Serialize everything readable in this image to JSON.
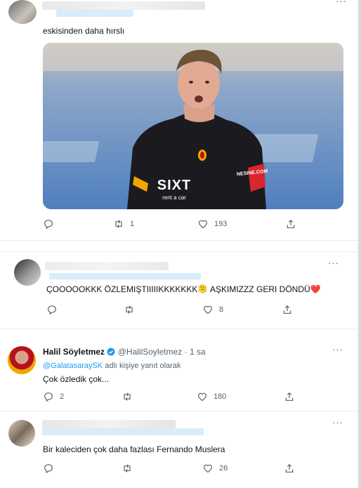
{
  "tweet1": {
    "text": "eskisinden daha hırslı",
    "actions": {
      "reply": "",
      "retweet": "1",
      "like": "193",
      "share": ""
    },
    "more": "···"
  },
  "photo": {
    "sponsor": "SIXT",
    "sponsor_sub": "rent a car",
    "sleeve": "NESINE.COM"
  },
  "tweet2": {
    "text": "ÇOOOOOKKK ÖZLEMIŞTIIIIIKKKKKKK🫠 AŞKIMIZZZ GERI DÖNDÜ❤️",
    "actions": {
      "reply": "",
      "retweet": "",
      "like": "8",
      "share": ""
    },
    "more": "···"
  },
  "tweet3": {
    "name": "Halil Söyletmez",
    "handle": "@HalilSoyletmez",
    "time": "· 1 sa",
    "reply_to_handle": "@GalatasaraySK",
    "reply_to_suffix": " adlı kişiye yanıt olarak",
    "text": "Çok özledik çok...",
    "actions": {
      "reply": "2",
      "retweet": "",
      "like": "180",
      "share": ""
    },
    "more": "···"
  },
  "tweet4": {
    "text": "Bir kaleciden çok daha fazlası Fernando Muslera",
    "actions": {
      "reply": "",
      "retweet": "",
      "like": "26",
      "share": ""
    },
    "more": "···"
  },
  "colors": {
    "accent": "#1d9bf0",
    "muted": "#536471",
    "heart": "#e0245e"
  },
  "icons": [
    "reply-icon",
    "retweet-icon",
    "like-icon",
    "share-icon",
    "verified-icon",
    "more-icon"
  ]
}
